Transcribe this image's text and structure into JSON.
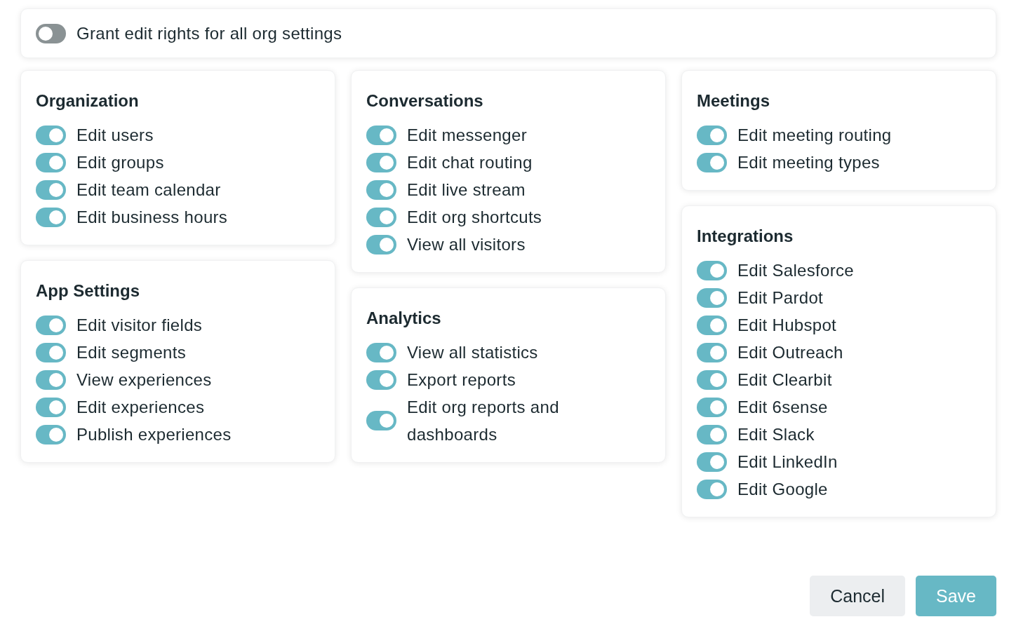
{
  "master": {
    "label": "Grant edit rights for all org settings",
    "on": false
  },
  "columns": [
    [
      {
        "title": "Organization",
        "items": [
          {
            "label": "Edit users",
            "on": true
          },
          {
            "label": "Edit groups",
            "on": true
          },
          {
            "label": "Edit team calendar",
            "on": true
          },
          {
            "label": "Edit business hours",
            "on": true
          }
        ]
      },
      {
        "title": "App Settings",
        "items": [
          {
            "label": "Edit visitor fields",
            "on": true
          },
          {
            "label": "Edit segments",
            "on": true
          },
          {
            "label": "View experiences",
            "on": true
          },
          {
            "label": "Edit experiences",
            "on": true
          },
          {
            "label": "Publish experiences",
            "on": true
          }
        ]
      }
    ],
    [
      {
        "title": "Conversations",
        "items": [
          {
            "label": "Edit messenger",
            "on": true
          },
          {
            "label": "Edit chat routing",
            "on": true
          },
          {
            "label": "Edit live stream",
            "on": true
          },
          {
            "label": "Edit org shortcuts",
            "on": true
          },
          {
            "label": "View all visitors",
            "on": true
          }
        ]
      },
      {
        "title": "Analytics",
        "items": [
          {
            "label": "View all statistics",
            "on": true
          },
          {
            "label": "Export reports",
            "on": true
          },
          {
            "label": "Edit org reports and dashboards",
            "on": true
          }
        ]
      }
    ],
    [
      {
        "title": "Meetings",
        "items": [
          {
            "label": "Edit meeting routing",
            "on": true
          },
          {
            "label": "Edit meeting types",
            "on": true
          }
        ]
      },
      {
        "title": "Integrations",
        "items": [
          {
            "label": "Edit Salesforce",
            "on": true
          },
          {
            "label": "Edit Pardot",
            "on": true
          },
          {
            "label": "Edit Hubspot",
            "on": true
          },
          {
            "label": "Edit Outreach",
            "on": true
          },
          {
            "label": "Edit Clearbit",
            "on": true
          },
          {
            "label": "Edit 6sense",
            "on": true
          },
          {
            "label": "Edit Slack",
            "on": true
          },
          {
            "label": "Edit LinkedIn",
            "on": true
          },
          {
            "label": "Edit Google",
            "on": true
          }
        ]
      }
    ]
  ],
  "buttons": [
    {
      "label": "Cancel",
      "kind": "secondary"
    },
    {
      "label": "Save",
      "kind": "primary"
    }
  ]
}
